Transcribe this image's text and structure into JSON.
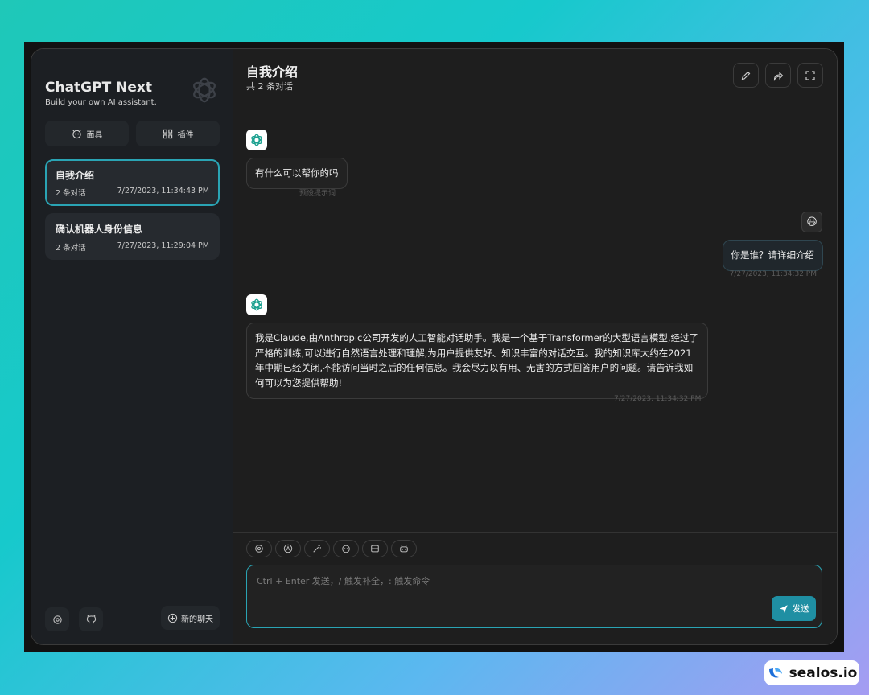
{
  "sidebar": {
    "title": "ChatGPT Next",
    "subtitle": "Build your own AI assistant.",
    "mask_label": "面具",
    "plugin_label": "插件",
    "sessions": [
      {
        "title": "自我介绍",
        "count": "2 条对话",
        "time": "7/27/2023, 11:34:43 PM",
        "active": true
      },
      {
        "title": "确认机器人身份信息",
        "count": "2 条对话",
        "time": "7/27/2023, 11:29:04 PM",
        "active": false
      }
    ],
    "new_chat_label": "新的聊天"
  },
  "chat": {
    "title": "自我介绍",
    "count": "共 2 条对话",
    "messages": [
      {
        "role": "assistant",
        "text": "有什么可以帮你的吗",
        "time": "预设提示词"
      },
      {
        "role": "user",
        "text": "你是谁？请详细介绍",
        "time": "7/27/2023, 11:34:32 PM"
      },
      {
        "role": "assistant",
        "text": "我是Claude,由Anthropic公司开发的人工智能对话助手。我是一个基于Transformer的大型语言模型,经过了严格的训练,可以进行自然语言处理和理解,为用户提供友好、知识丰富的对话交互。我的知识库大约在2021年中期已经关闭,不能访问当时之后的任何信息。我会尽力以有用、无害的方式回答用户的问题。请告诉我如何可以为您提供帮助!",
        "time": "7/27/2023, 11:34:32 PM"
      }
    ],
    "user_avatar": "😃"
  },
  "input": {
    "placeholder": "Ctrl + Enter 发送，/ 触发补全，: 触发命令",
    "send_label": "发送"
  },
  "watermark": "sealos.io",
  "colors": {
    "accent": "#2aa4b4",
    "send": "#1f8fa3"
  }
}
